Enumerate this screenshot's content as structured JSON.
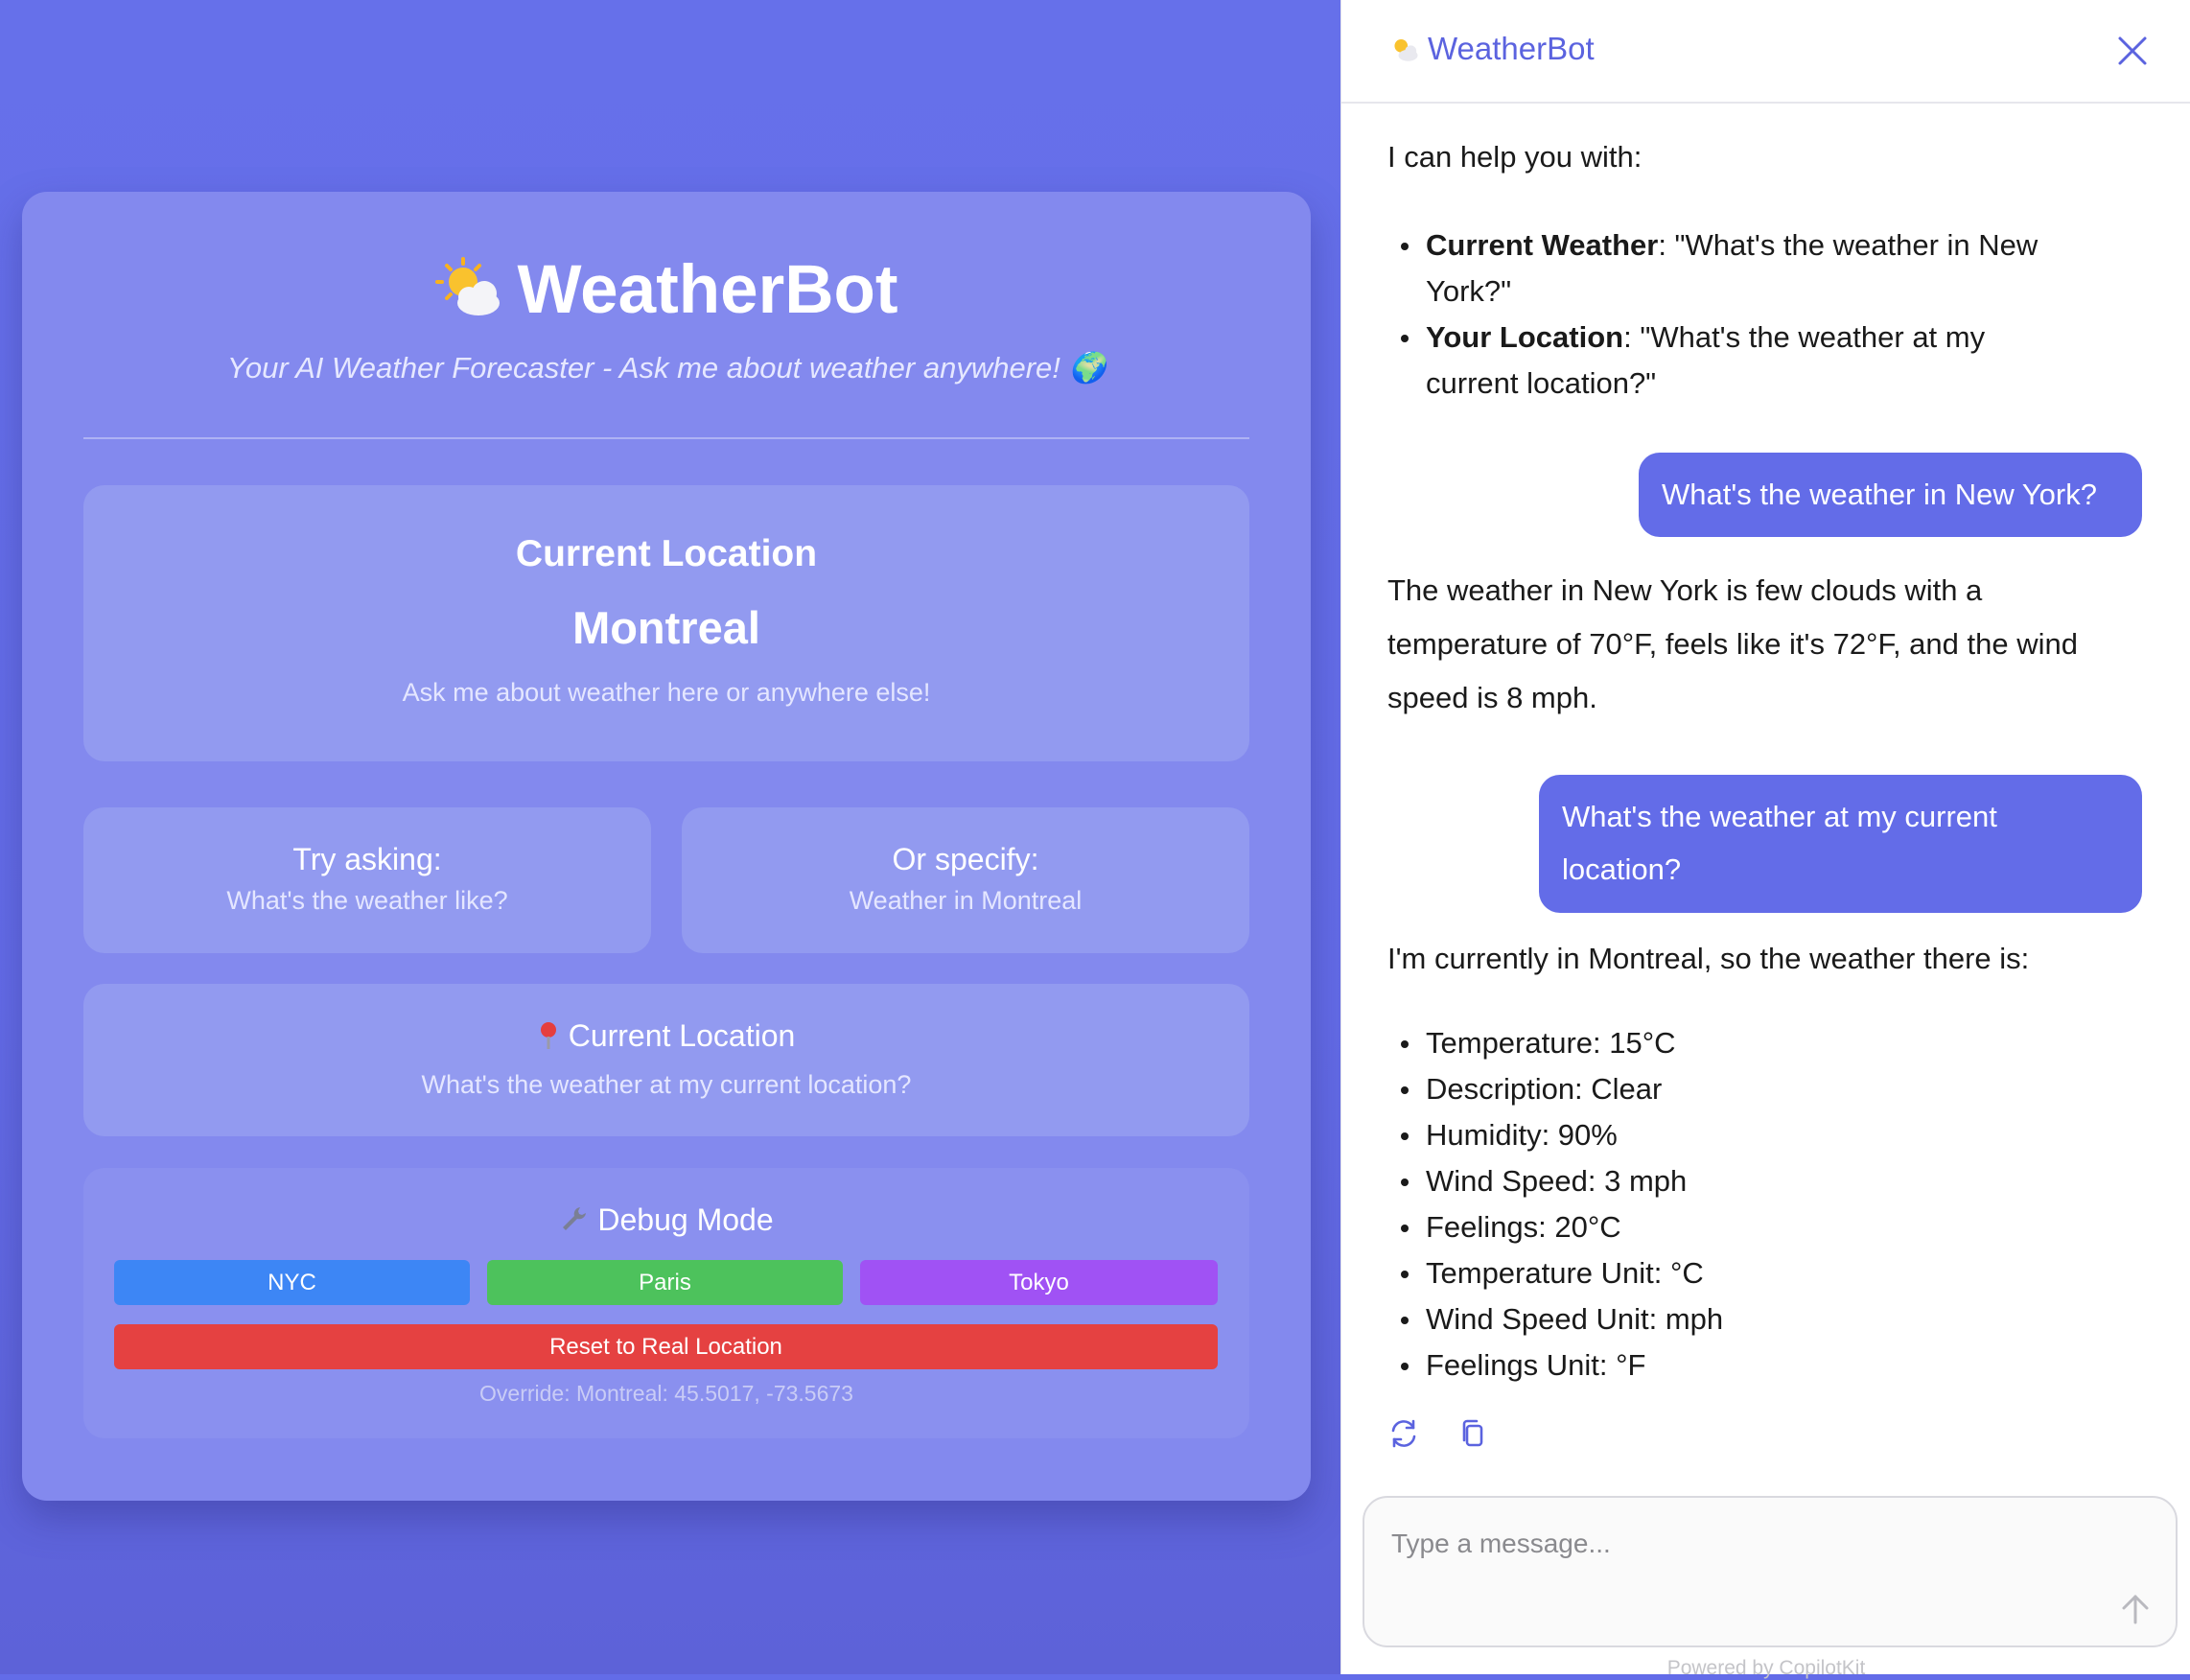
{
  "app": {
    "title": "WeatherBot",
    "subtitle": "Your AI Weather Forecaster - Ask me about weather anywhere! 🌍",
    "current_location": {
      "heading": "Current Location",
      "city": "Montreal",
      "hint": "Ask me about weather here or anywhere else!"
    },
    "tips": [
      {
        "title": "Try asking:",
        "example": "What's the weather like?"
      },
      {
        "title": "Or specify:",
        "example": "Weather in Montreal"
      }
    ],
    "current_location_prompt": {
      "title": "Current Location",
      "example": "What's the weather at my current location?"
    },
    "debug": {
      "title": "Debug Mode",
      "buttons": {
        "nyc": "NYC",
        "paris": "Paris",
        "tokyo": "Tokyo",
        "reset": "Reset to Real Location"
      },
      "override": "Override: Montreal: 45.5017, -73.5673"
    }
  },
  "sidebar": {
    "title": "WeatherBot",
    "intro": "I can help you with:",
    "capabilities": [
      {
        "bold": "Current Weather",
        "text": ": \"What's the weather in New",
        "text2": "York?\""
      },
      {
        "bold": "Your Location",
        "text": ": \"What's the weather at my",
        "text2": "current location?\""
      }
    ],
    "user_message_1": "What's the weather in New York?",
    "bot_reply_1": [
      "The weather in New York is few clouds with a",
      "temperature of 70°F, feels like it's 72°F, and the wind",
      "speed is 8 mph."
    ],
    "user_message_2": [
      "What's the weather at my current",
      "location?"
    ],
    "bot_reply_2_intro": "I'm currently in Montreal, so the weather there is:",
    "bot_reply_2_items": [
      "Temperature: 15°C",
      "Description: Clear",
      "Humidity: 90%",
      "Wind Speed: 3 mph",
      "Feelings: 20°C",
      "Temperature Unit: °C",
      "Wind Speed Unit: mph",
      "Feelings Unit: °F"
    ],
    "input": {
      "placeholder": "Type a message..."
    },
    "footer": "Powered by CopilotKit"
  },
  "colors": {
    "background": "#636ce8",
    "accent": "#5b63df",
    "nyc": "#3d86f5",
    "paris": "#4dc25c",
    "tokyo": "#a052f4",
    "reset": "#e54141"
  },
  "icons": [
    "sun-cloud-icon",
    "globe-icon",
    "pin-icon",
    "wrench-icon",
    "close-icon",
    "regenerate-icon",
    "copy-icon",
    "send-arrow-icon"
  ]
}
